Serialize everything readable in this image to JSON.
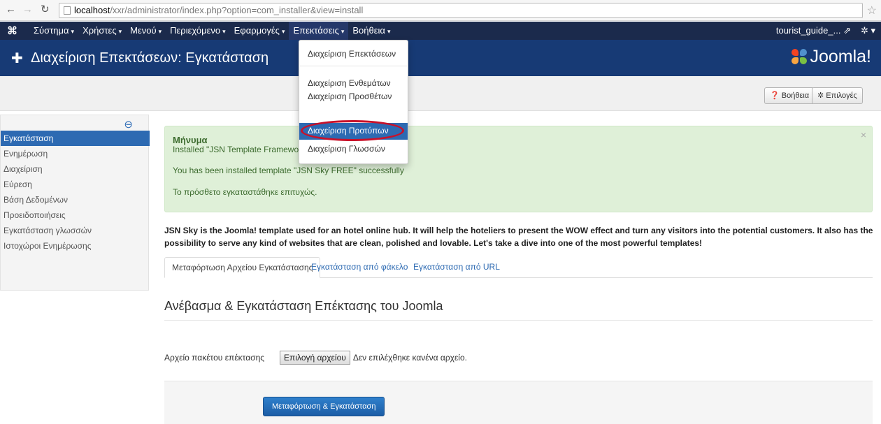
{
  "browser": {
    "url_host": "localhost",
    "url_path": "/xxr/administrator/index.php?option=com_installer&view=install"
  },
  "navbar": {
    "menu": [
      {
        "label": "Σύστημα"
      },
      {
        "label": "Χρήστες"
      },
      {
        "label": "Μενού"
      },
      {
        "label": "Περιεχόμενο"
      },
      {
        "label": "Εφαρμογές"
      },
      {
        "label": "Επεκτάσεις"
      },
      {
        "label": "Βοήθεια"
      }
    ],
    "site_name": "tourist_guide_...",
    "active_index": 5
  },
  "header": {
    "title": "Διαχείριση Επεκτάσεων: Εγκατάσταση",
    "brand": "Joomla!"
  },
  "toolbar": {
    "help_label": "Βοήθεια",
    "options_label": "Επιλογές"
  },
  "sidebar": {
    "items": [
      {
        "label": "Εγκατάσταση",
        "active": true
      },
      {
        "label": "Ενημέρωση"
      },
      {
        "label": "Διαχείριση"
      },
      {
        "label": "Εύρεση"
      },
      {
        "label": "Βάση Δεδομένων"
      },
      {
        "label": "Προειδοποιήσεις"
      },
      {
        "label": "Εγκατάσταση γλωσσών"
      },
      {
        "label": "Ιστοχώροι Ενημέρωσης"
      }
    ]
  },
  "message": {
    "title": "Μήνυμα",
    "lines": [
      "Installed \"JSN Template Framework\" from",
      "You has been installed template \"JSN Sky FREE\" successfully",
      "Το πρόσθετο εγκαταστάθηκε επιτυχώς."
    ]
  },
  "description": "JSN Sky is the Joomla! template used for an hotel online hub. It will help the hoteliers to present the WOW effect and turn any visitors into the potential customers. It also has the possibility to serve any kind of websites that are clean, polished and lovable. Let's take a dive into one of the most powerful templates!",
  "tabs": [
    {
      "label": "Μεταφόρτωση Αρχείου Εγκατάστασης",
      "active": true
    },
    {
      "label": "Εγκατάσταση από φάκελο"
    },
    {
      "label": "Εγκατάσταση από URL"
    }
  ],
  "upload": {
    "section_title": "Ανέβασμα & Εγκατάσταση Επέκτασης του Joomla",
    "file_label": "Αρχείο πακέτου επέκτασης",
    "choose_button": "Επιλογή αρχείου",
    "no_file_text": "Δεν επιλέχθηκε κανένα αρχείο.",
    "submit_button": "Μεταφόρτωση & Εγκατάσταση"
  },
  "dropdown": {
    "items": [
      {
        "label": "Διαχείριση Επεκτάσεων"
      },
      {
        "label": "Διαχείριση Ενθεμάτων"
      },
      {
        "label": "Διαχείριση Προσθέτων"
      },
      {
        "label": "Διαχείριση Προτύπων",
        "highlighted": true
      },
      {
        "label": "Διαχείριση Γλωσσών"
      }
    ]
  },
  "colors": {
    "navbar_bg": "#1b2a4c",
    "header_bg": "#173a75",
    "accent": "#2d6ab2",
    "success_bg": "#dff0d8",
    "annotation_red": "#c8112a"
  }
}
